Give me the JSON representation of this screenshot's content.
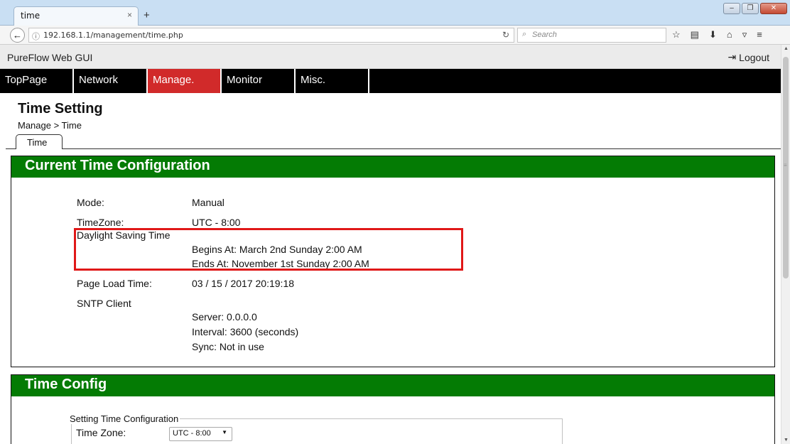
{
  "browser": {
    "tab_title": "time",
    "tab_close": "×",
    "new_tab": "+",
    "url": "192.168.1.1/management/time.php",
    "search_placeholder": "Search"
  },
  "app": {
    "title": "PureFlow Web GUI",
    "logout_label": "Logout",
    "menu": [
      {
        "label": "TopPage",
        "active": false
      },
      {
        "label": "Network",
        "active": false
      },
      {
        "label": "Manage.",
        "active": true
      },
      {
        "label": "Monitor",
        "active": false
      },
      {
        "label": "Misc.",
        "active": false
      }
    ],
    "page_title": "Time Setting",
    "breadcrumb": "Manage > Time",
    "subtab": "Time"
  },
  "current_config": {
    "header": "Current Time Configuration",
    "mode_label": "Mode:",
    "mode_value": "Manual",
    "timezone_label": "TimeZone:",
    "timezone_value": "UTC - 8:00",
    "dst_label": "Daylight Saving Time",
    "dst_begins": "Begins At: March 2nd Sunday 2:00 AM",
    "dst_ends": "Ends At: November 1st Sunday 2:00 AM",
    "pageload_label": "Page Load Time:",
    "pageload_value": "03 / 15 / 2017 20:19:18",
    "sntp_label": "SNTP Client",
    "sntp_server": "Server: 0.0.0.0",
    "sntp_interval": "Interval: 3600 (seconds)",
    "sntp_sync": "Sync: Not in use"
  },
  "time_config": {
    "header": "Time Config",
    "fieldset_legend": "Setting Time Configuration",
    "timezone_label": "Time Zone:",
    "timezone_selected": "UTC - 8:00"
  },
  "colors": {
    "accent_green": "#047b04",
    "active_menu": "#d12a2a",
    "highlight_red": "#e01818"
  }
}
